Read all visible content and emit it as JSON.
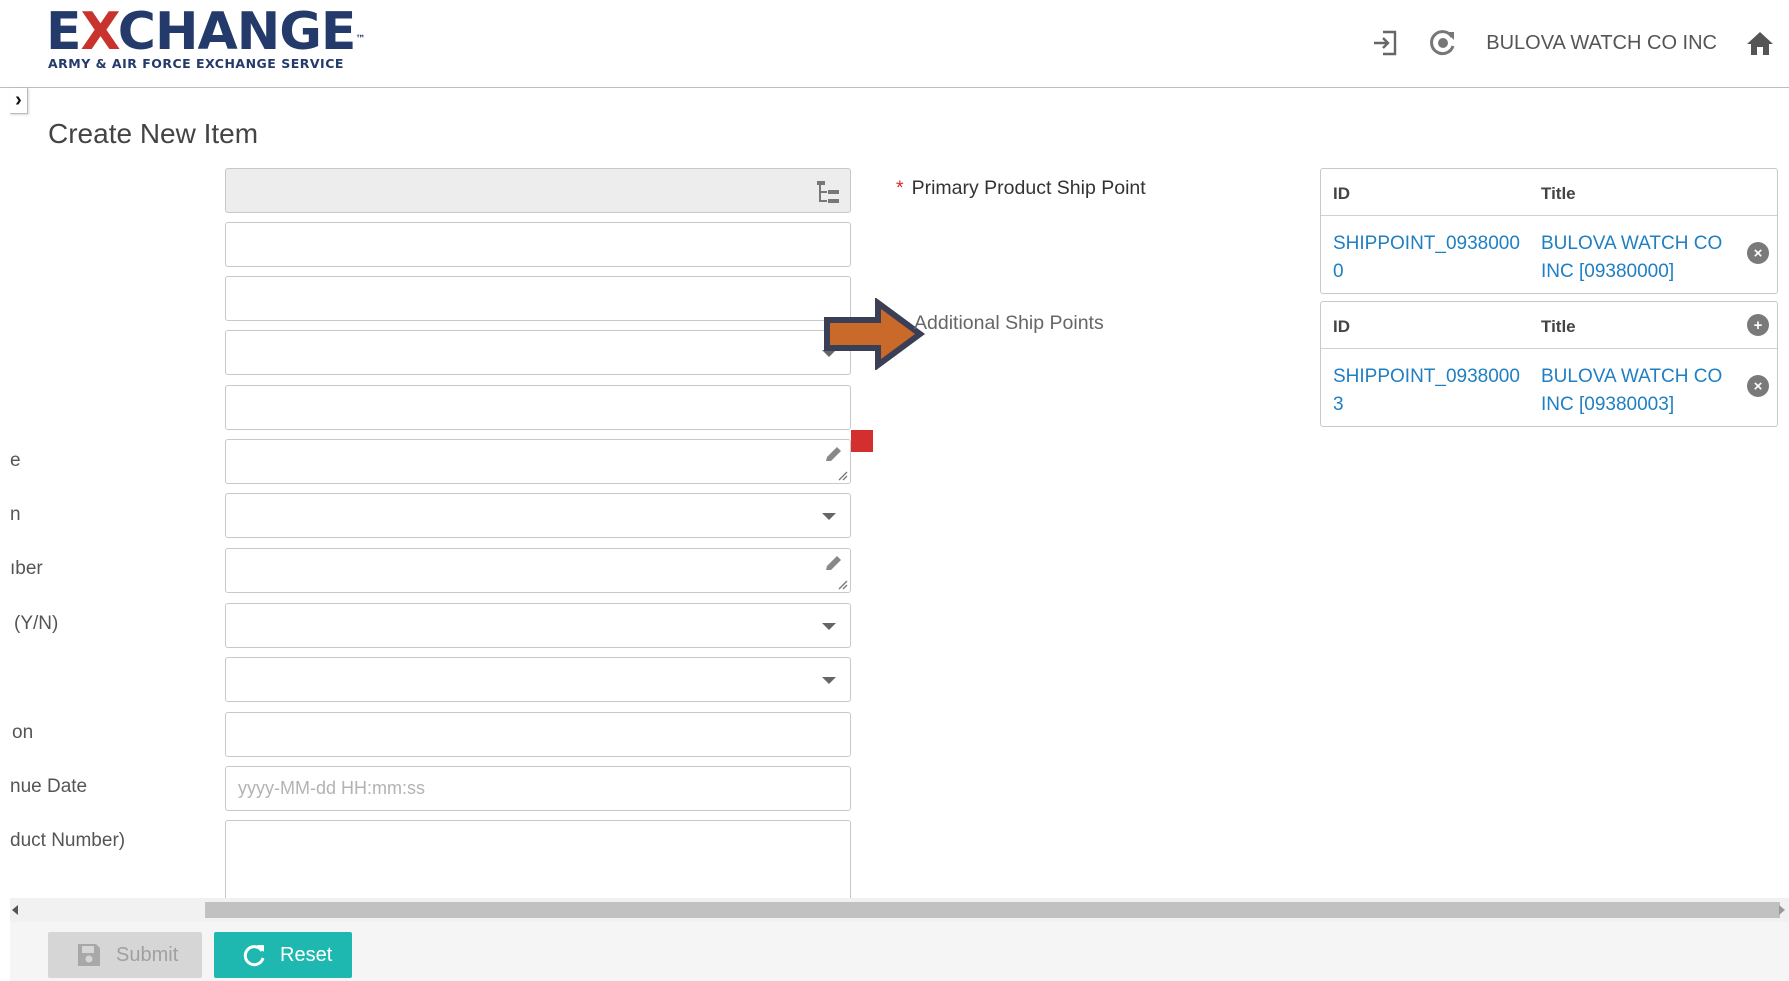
{
  "header": {
    "logo_main_pre": "E",
    "logo_main_x": "X",
    "logo_main_post": "CHANGE",
    "logo_tm": "™",
    "logo_sub": "ARMY & AIR FORCE EXCHANGE SERVICE",
    "user_name": "BULOVA WATCH CO INC",
    "icons": [
      "sign-in-icon",
      "refresh-icon",
      "home-icon"
    ]
  },
  "sidebar": {
    "toggle_glyph": "›"
  },
  "page": {
    "title": "Create New Item"
  },
  "form": {
    "labels": {
      "l6": "e",
      "l7": "n",
      "l8": "ıber",
      "l9": "(Y/N)",
      "l11": "on",
      "l12": "nue Date",
      "l13": "duct Number)"
    },
    "date_placeholder": "yyyy-MM-dd HH:mm:ss",
    "required_indicator_color": "#d32f2f"
  },
  "ship_points": {
    "primary_label": "Primary Product Ship Point",
    "required_star": "*",
    "additional_label": "Additional Ship Points",
    "col_id": "ID",
    "col_title": "Title",
    "primary_rows": [
      {
        "id": "SHIPPOINT_09380000",
        "title": "BULOVA WATCH CO INC [09380000]"
      }
    ],
    "additional_rows": [
      {
        "id": "SHIPPOINT_09380003",
        "title": "BULOVA WATCH CO INC [09380003]"
      }
    ],
    "pointer_arrow_color": "#c96a2b"
  },
  "footer": {
    "submit_label": "Submit",
    "reset_label": "Reset",
    "reset_color": "#1fb8b0"
  }
}
